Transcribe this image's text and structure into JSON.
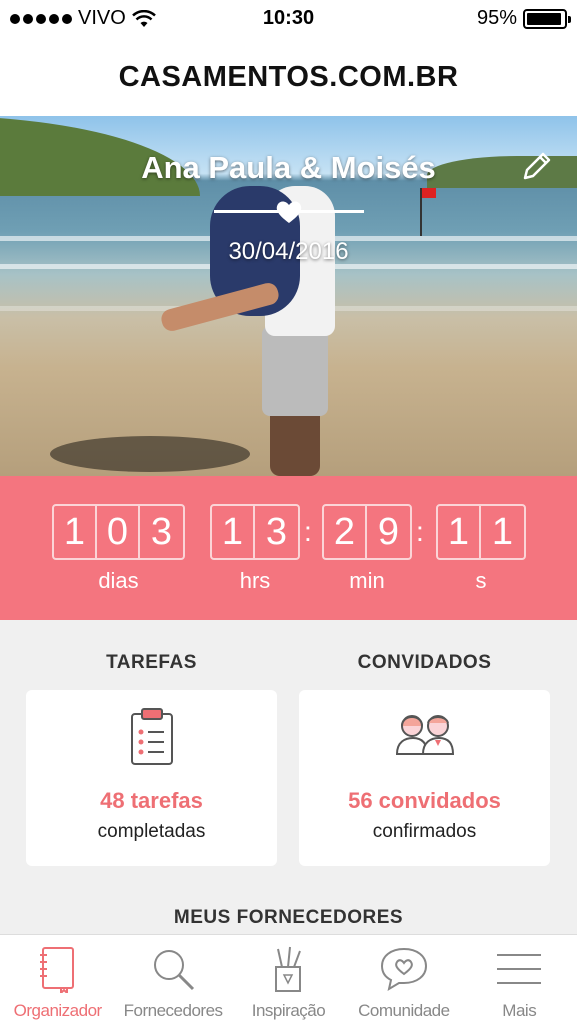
{
  "status_bar": {
    "carrier": "VIVO",
    "time": "10:30",
    "battery": "95%",
    "battery_level": 0.95
  },
  "header": {
    "title": "CASAMENTOS.COM.BR"
  },
  "hero": {
    "couple_name": "Ana Paula & Moisés",
    "date": "30/04/2016"
  },
  "countdown": {
    "days": [
      "1",
      "0",
      "3"
    ],
    "hours": [
      "1",
      "3"
    ],
    "minutes": [
      "2",
      "9"
    ],
    "seconds": [
      "1",
      "1"
    ],
    "separator": ":",
    "labels": {
      "days": "dias",
      "hours": "hrs",
      "minutes": "min",
      "seconds": "s"
    }
  },
  "summary": {
    "tasks": {
      "title": "TAREFAS",
      "count": "48 tarefas",
      "sub": "completadas"
    },
    "guests": {
      "title": "CONVIDADOS",
      "count": "56 convidados",
      "sub": "confirmados"
    }
  },
  "vendors": {
    "title": "MEUS FORNECEDORES"
  },
  "tab_bar": {
    "items": [
      {
        "label": "Organizador",
        "icon": "notebook-icon",
        "active": true
      },
      {
        "label": "Fornecedores",
        "icon": "search-icon",
        "active": false
      },
      {
        "label": "Inspiração",
        "icon": "pencil-cup-icon",
        "active": false
      },
      {
        "label": "Comunidade",
        "icon": "chat-heart-icon",
        "active": false
      },
      {
        "label": "Mais",
        "icon": "menu-icon",
        "active": false
      }
    ]
  },
  "colors": {
    "accent": "#f4757f",
    "accent_text": "#ee6f74",
    "inactive": "#888888"
  }
}
